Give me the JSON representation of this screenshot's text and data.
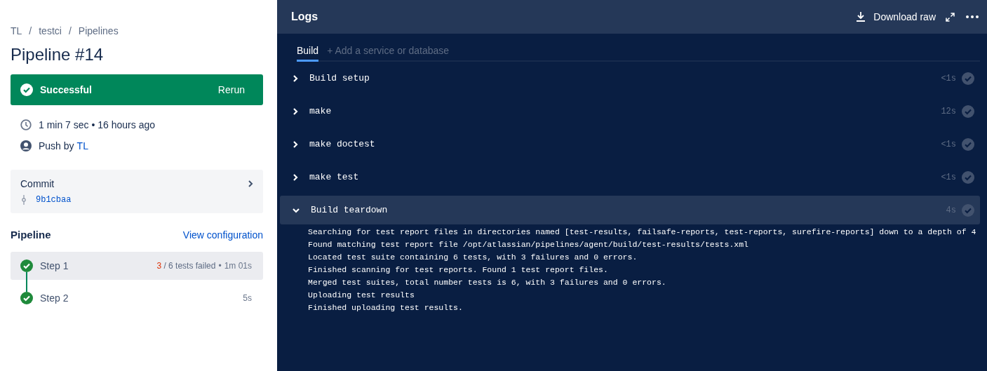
{
  "breadcrumbs": [
    {
      "label": "TL"
    },
    {
      "separator": "/",
      "label": "testci"
    },
    {
      "separator": "/",
      "label": "Pipelines"
    }
  ],
  "title": "Pipeline #14",
  "status": {
    "label": "Successful",
    "kind": "success",
    "action": "Rerun"
  },
  "meta": {
    "duration": "1 min 7 sec • 16 hours ago",
    "trigger": "Push by",
    "author": "TL"
  },
  "commit": {
    "label": "Commit",
    "hash": "9b1cbaa"
  },
  "pipeline": {
    "heading": "Pipeline",
    "link": "View configuration",
    "steps": [
      {
        "name": "Step 1",
        "selected": true,
        "failed_count": "3",
        "tests_text": "/ 6 tests failed",
        "separator": "•",
        "duration": "1m 01s"
      },
      {
        "name": "Step 2",
        "selected": false,
        "duration": "5s"
      }
    ]
  },
  "logs": {
    "title": "Logs",
    "download": "Download raw",
    "tabs": [
      {
        "label": "Build",
        "selected": true
      },
      {
        "label": "+ Add a service or database",
        "selected": false
      }
    ],
    "sections": [
      {
        "name": "Build setup",
        "time": "<1s",
        "expanded": false
      },
      {
        "name": "make",
        "time": "12s",
        "expanded": false
      },
      {
        "name": "make doctest",
        "time": "<1s",
        "expanded": false
      },
      {
        "name": "make test",
        "time": "<1s",
        "expanded": false
      },
      {
        "name": "Build teardown",
        "time": "4s",
        "expanded": true,
        "lines": [
          "Searching for test report files in directories named [test-results, failsafe-reports, test-reports, surefire-reports] down to a depth of 4",
          "Found matching test report file /opt/atlassian/pipelines/agent/build/test-results/tests.xml",
          "Located test suite containing 6 tests, with 3 failures and 0 errors.",
          "Finished scanning for test reports. Found 1 test report files.",
          "Merged test suites, total number tests is 6, with 3 failures and 0 errors.",
          "Uploading test results",
          "Finished uploading test results."
        ]
      }
    ]
  }
}
